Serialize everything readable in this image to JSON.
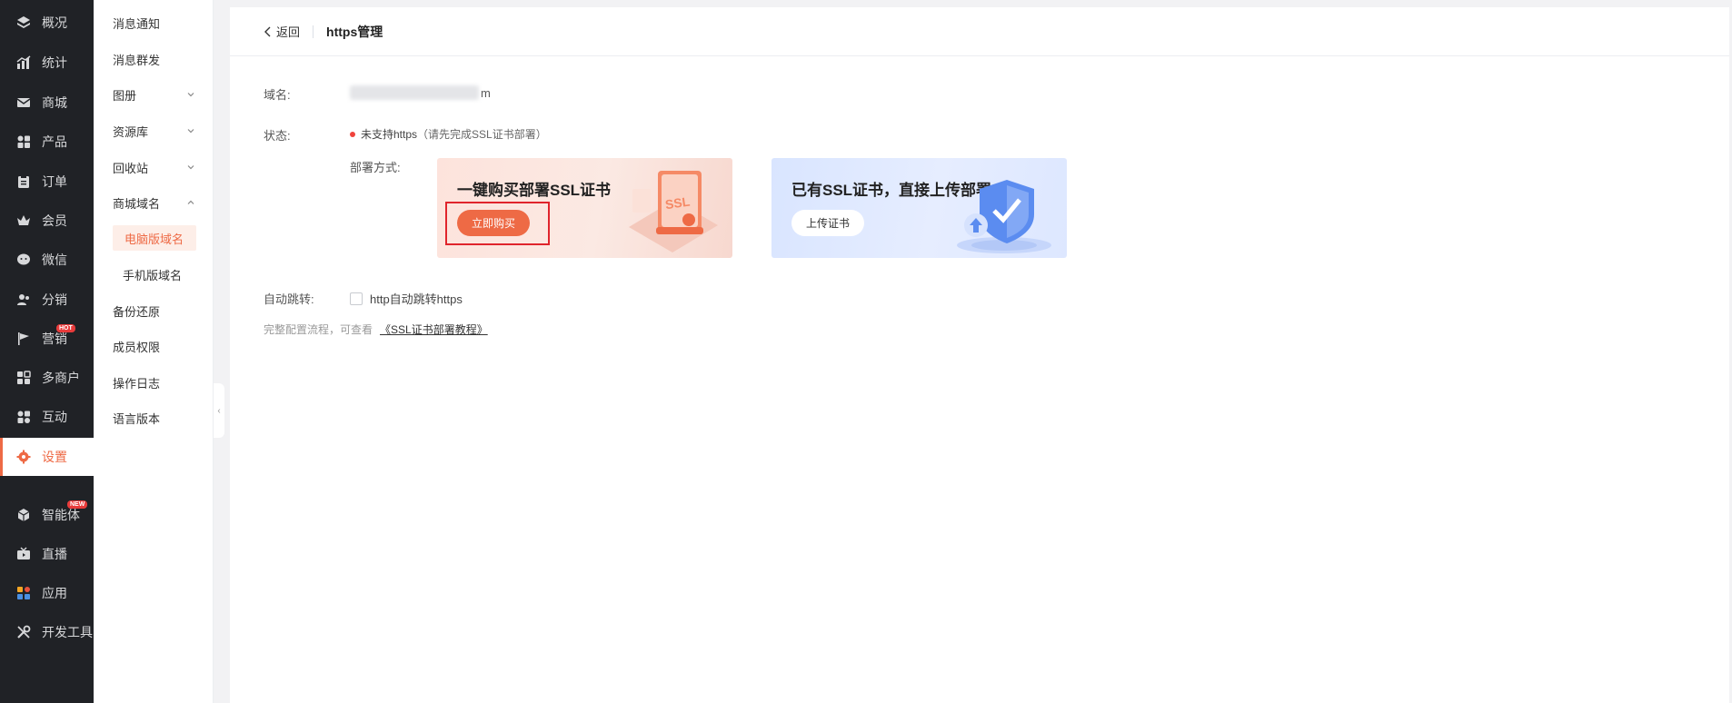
{
  "nav": {
    "items": [
      {
        "label": "概况",
        "icon": "layers-icon"
      },
      {
        "label": "统计",
        "icon": "chart-icon"
      },
      {
        "label": "商城",
        "icon": "mail-icon"
      },
      {
        "label": "产品",
        "icon": "grid-icon"
      },
      {
        "label": "订单",
        "icon": "clipboard-icon"
      },
      {
        "label": "会员",
        "icon": "crown-icon"
      },
      {
        "label": "微信",
        "icon": "wechat-icon"
      },
      {
        "label": "分销",
        "icon": "users-icon"
      },
      {
        "label": "营销",
        "icon": "flag-icon",
        "badge": "HOT"
      },
      {
        "label": "多商户",
        "icon": "store-icon"
      },
      {
        "label": "互动",
        "icon": "apps-icon"
      },
      {
        "label": "设置",
        "icon": "gear-icon",
        "active": true
      },
      {
        "label": "智能体",
        "icon": "cube-icon",
        "badge": "NEW"
      },
      {
        "label": "直播",
        "icon": "tv-icon"
      },
      {
        "label": "应用",
        "icon": "app-grid-icon"
      },
      {
        "label": "开发工具",
        "icon": "tools-icon"
      }
    ]
  },
  "submenu": {
    "items": [
      {
        "label": "消息通知"
      },
      {
        "label": "消息群发"
      },
      {
        "label": "图册",
        "chevron": "down"
      },
      {
        "label": "资源库",
        "chevron": "down"
      },
      {
        "label": "回收站",
        "chevron": "down"
      },
      {
        "label": "商城域名",
        "chevron": "up"
      },
      {
        "label": "电脑版域名",
        "child": true,
        "selected": true
      },
      {
        "label": "手机版域名",
        "child": true
      },
      {
        "label": "备份还原"
      },
      {
        "label": "成员权限"
      },
      {
        "label": "操作日志"
      },
      {
        "label": "语言版本"
      }
    ]
  },
  "header": {
    "back_label": "返回",
    "title": "https管理"
  },
  "form": {
    "domain_label": "域名:",
    "domain_suffix": "m",
    "status_label": "状态:",
    "status_text": "未支持https",
    "status_hint": "（请先完成SSL证书部署）",
    "deploy_label": "部署方式:",
    "auto_label": "自动跳转:",
    "auto_checkbox_label": "http自动跳转https",
    "tip_text": "完整配置流程，可查看",
    "tip_link": "《SSL证书部署教程》"
  },
  "cards": {
    "buy": {
      "title": "一键购买部署SSL证书",
      "button": "立即购买",
      "illustration_text": "SSL"
    },
    "upload": {
      "title": "已有SSL证书，直接上传部署",
      "button": "上传证书"
    }
  },
  "colors": {
    "accent": "#ee6a45",
    "nav_bg": "#202226",
    "status_dot": "#f0433c",
    "highlight_box": "#e0242c"
  }
}
